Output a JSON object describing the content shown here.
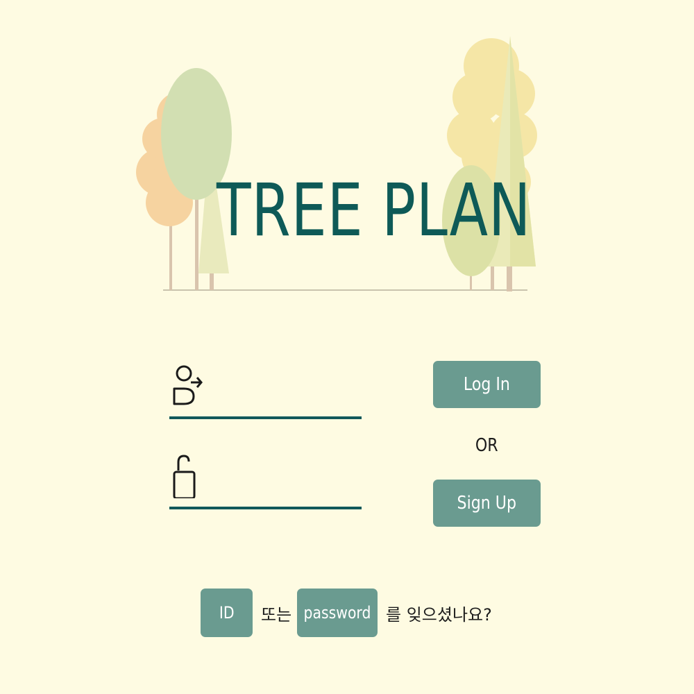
{
  "header": {
    "title": "TREE PLAN"
  },
  "login_form": {
    "id_field": {
      "icon": "user-login-icon",
      "value": "",
      "placeholder": ""
    },
    "password_field": {
      "icon": "unlock-icon",
      "value": "",
      "placeholder": ""
    },
    "login_label": "Log In",
    "or_label": "OR",
    "signup_label": "Sign Up"
  },
  "recovery": {
    "id_label": "ID",
    "connector": "또는",
    "password_label": "password",
    "question": "를 잊으셨나요?"
  },
  "colors": {
    "background": "#fefbe2",
    "title": "#0e5a57",
    "button": "#6a9b90",
    "underline": "#11585a"
  }
}
